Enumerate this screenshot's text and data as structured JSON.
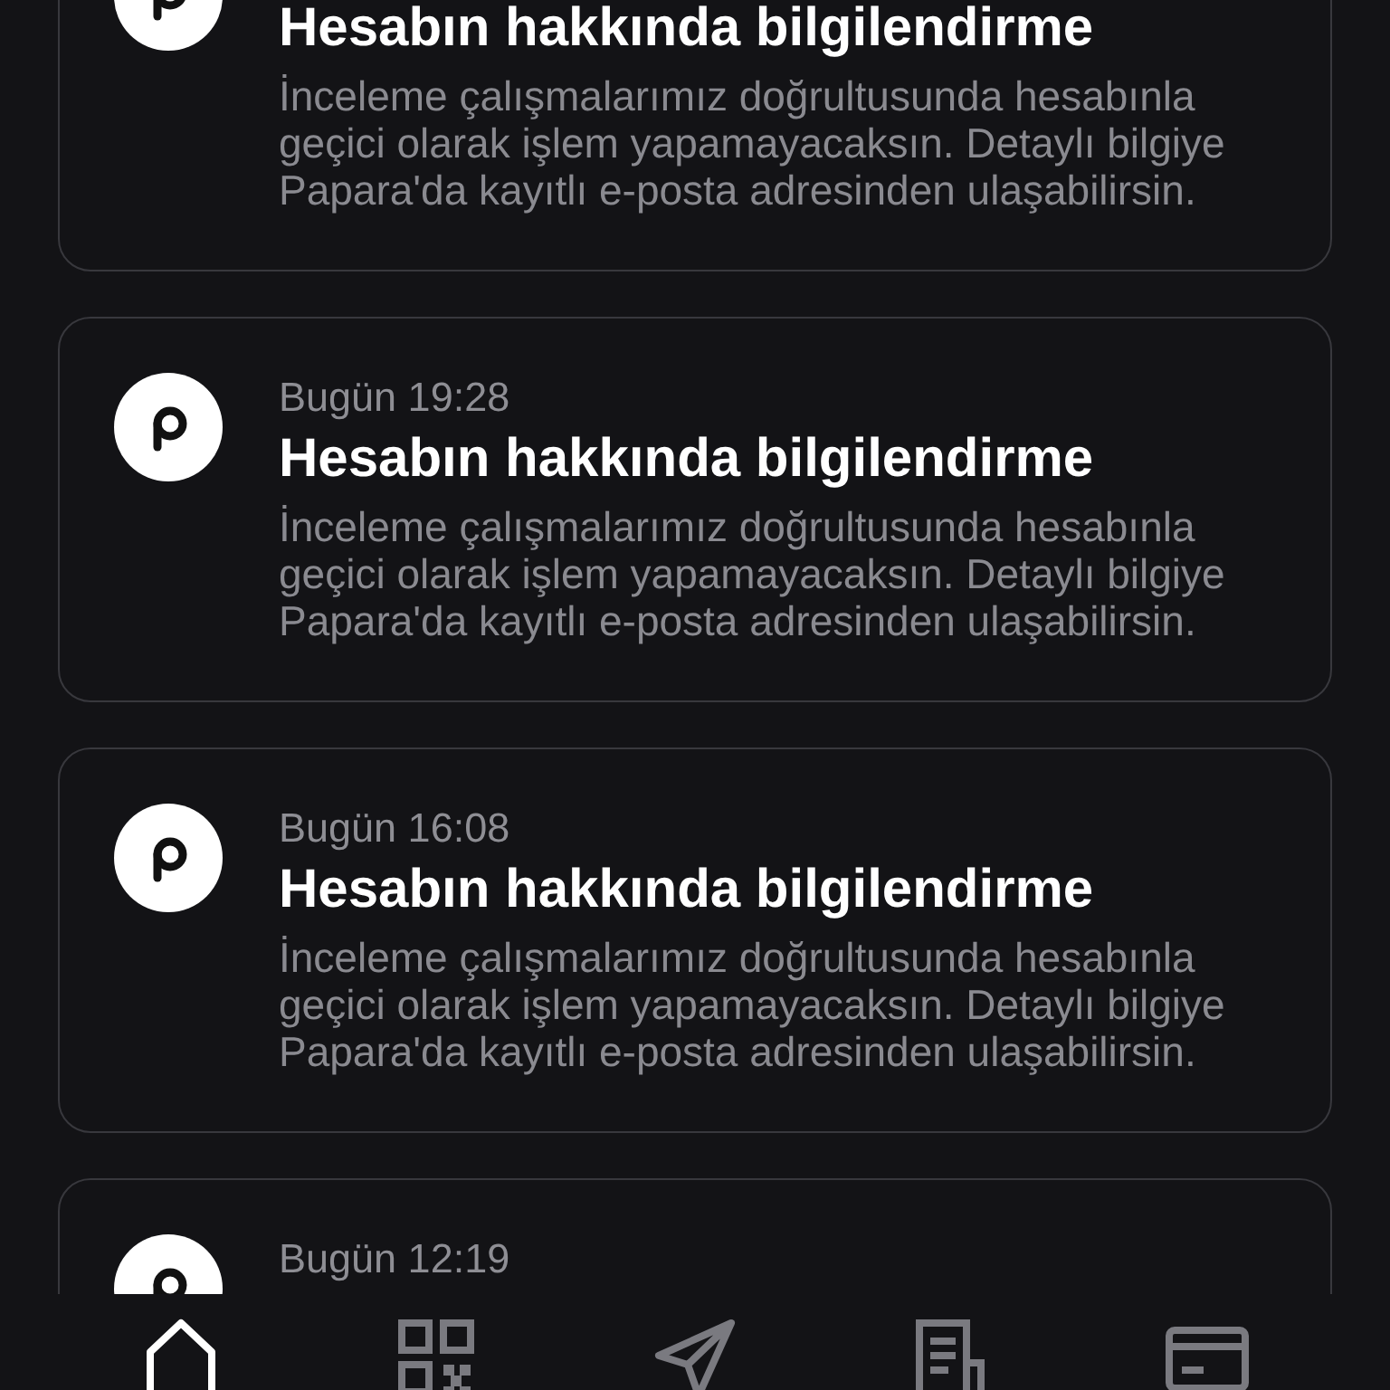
{
  "notifications": [
    {
      "title": "Hesabın hakkında bilgilendirme",
      "body": "İnceleme çalışmalarımız doğrultusunda hesabınla geçici olarak işlem yapamayacaksın. Detaylı bilgiye Papara'da kayıtlı e-posta adresinden ulaşabilirsin."
    },
    {
      "time": "Bugün 19:28",
      "title": "Hesabın hakkında bilgilendirme",
      "body": "İnceleme çalışmalarımız doğrultusunda hesabınla geçici olarak işlem yapamayacaksın. Detaylı bilgiye Papara'da kayıtlı e-posta adresinden ulaşabilirsin."
    },
    {
      "time": "Bugün 16:08",
      "title": "Hesabın hakkında bilgilendirme",
      "body": "İnceleme çalışmalarımız doğrultusunda hesabınla geçici olarak işlem yapamayacaksın. Detaylı bilgiye Papara'da kayıtlı e-posta adresinden ulaşabilirsin."
    },
    {
      "time": "Bugün 12:19"
    }
  ],
  "bottom_nav": [
    {
      "kind": "home",
      "selected": true
    },
    {
      "kind": "qr",
      "selected": false
    },
    {
      "kind": "send",
      "selected": false
    },
    {
      "kind": "receipt",
      "selected": false
    },
    {
      "kind": "card",
      "selected": false
    }
  ]
}
